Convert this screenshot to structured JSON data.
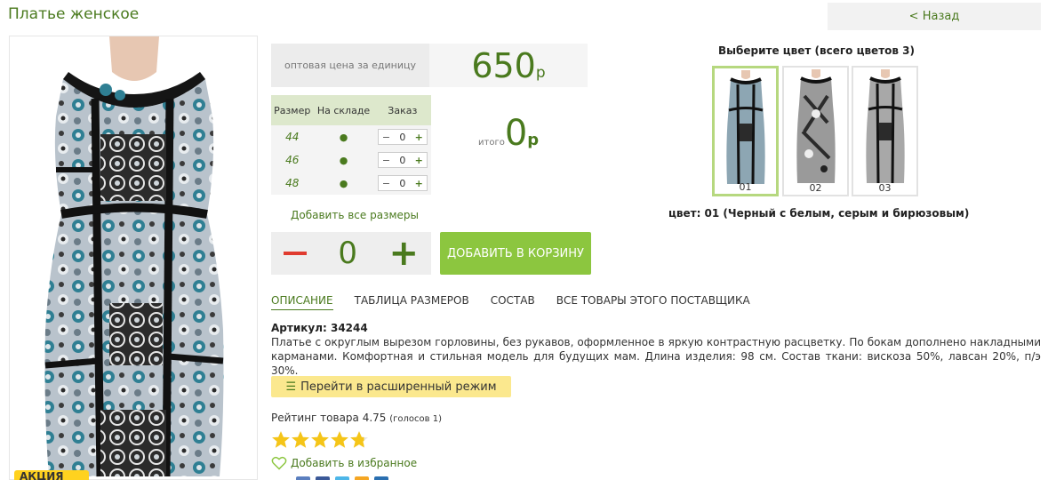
{
  "page": {
    "title": "Платье женское",
    "back_label": "< Назад"
  },
  "promo_tag": "АКЦИЯ",
  "price": {
    "label": "оптовая цена за единицу",
    "value": "650",
    "currency": "р"
  },
  "sizes_table": {
    "headers": [
      "Размер",
      "На складе",
      "Заказ"
    ],
    "rows": [
      {
        "size": "44",
        "in_stock": "●",
        "qty": "0"
      },
      {
        "size": "46",
        "in_stock": "●",
        "qty": "0"
      },
      {
        "size": "48",
        "in_stock": "●",
        "qty": "0"
      }
    ],
    "minus": "−",
    "plus": "+"
  },
  "total": {
    "label": "итого",
    "value": "0",
    "currency": "р"
  },
  "add_all_sizes": "Добавить все размеры",
  "quantity": {
    "value": "0",
    "plus": "+"
  },
  "add_to_cart": "ДОБАВИТЬ В КОРЗИНУ",
  "colors": {
    "title": "Выберите цвет (всего цветов 3)",
    "thumbs": [
      {
        "label": "01",
        "selected": true
      },
      {
        "label": "02",
        "selected": false
      },
      {
        "label": "03",
        "selected": false
      }
    ],
    "selected_name": "цвет: 01 (Черный с белым, серым и бирюзовым)"
  },
  "tabs": [
    {
      "label": "ОПИСАНИЕ",
      "active": true
    },
    {
      "label": "ТАБЛИЦА РАЗМЕРОВ",
      "active": false
    },
    {
      "label": "СОСТАВ",
      "active": false
    },
    {
      "label": "ВСЕ ТОВАРЫ ЭТОГО ПОСТАВЩИКА",
      "active": false
    }
  ],
  "article": "Артикул: 34244",
  "description": "Платье с округлым вырезом горловины, без рукавов, оформленное в яркую контрастную расцветку. По бокам дополнено накладными карманами. Комфортная и стильная модель для будущих мам. Длина изделия: 98 см. Состав ткани: вискоза 50%, лавсан 20%, п/э 30%.",
  "advanced_mode": "Перейти в расширенный режим",
  "rating": {
    "label": "Рейтинг товара 4.75",
    "votes": "(голосов 1)",
    "value": 4.75,
    "max": 5
  },
  "favorite": "Добавить в избранное",
  "colors_palette": {
    "accent": "#4a7a1e",
    "button": "#8cc63f",
    "star": "#f5c518",
    "teal": "#3a8a9a"
  }
}
